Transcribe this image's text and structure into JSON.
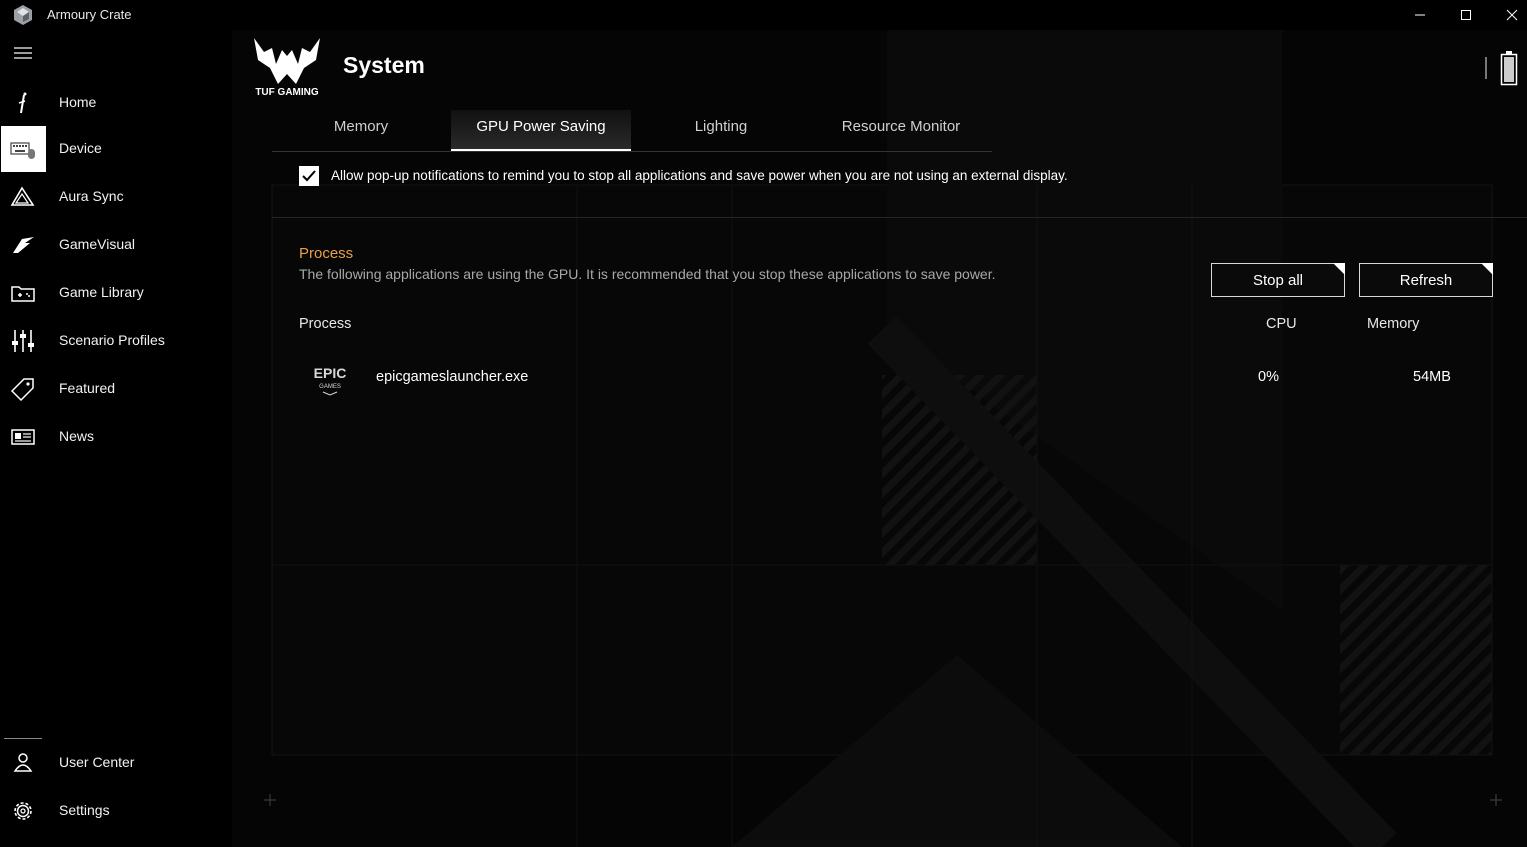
{
  "window": {
    "title": "Armoury Crate"
  },
  "sidebar": {
    "items": [
      {
        "label": "Home",
        "icon": "home-icon"
      },
      {
        "label": "Device",
        "icon": "keyboard-mouse-icon",
        "active": true
      },
      {
        "label": "Aura Sync",
        "icon": "aura-icon"
      },
      {
        "label": "GameVisual",
        "icon": "gamevisual-icon"
      },
      {
        "label": "Game Library",
        "icon": "game-library-icon"
      },
      {
        "label": "Scenario Profiles",
        "icon": "sliders-icon"
      },
      {
        "label": "Featured",
        "icon": "tag-icon"
      },
      {
        "label": "News",
        "icon": "news-icon"
      }
    ],
    "bottom": [
      {
        "label": "User Center",
        "icon": "user-icon"
      },
      {
        "label": "Settings",
        "icon": "gear-icon"
      }
    ]
  },
  "header": {
    "logo_text": "TUF GAMING",
    "title": "System"
  },
  "tabs": [
    {
      "label": "Memory"
    },
    {
      "label": "GPU Power Saving",
      "active": true
    },
    {
      "label": "Lighting"
    },
    {
      "label": "Resource Monitor"
    }
  ],
  "notification": {
    "checked": true,
    "label": "Allow pop-up notifications to remind you to stop all applications and save power when you are not using an external display."
  },
  "process_section": {
    "title": "Process",
    "description": "The following applications are using the GPU. It is recommended that you stop these applications to save power.",
    "stop_all_label": "Stop all",
    "refresh_label": "Refresh",
    "columns": {
      "process": "Process",
      "cpu": "CPU",
      "memory": "Memory"
    },
    "rows": [
      {
        "icon_text_top": "EPIC",
        "icon_text_bottom": "GAMES",
        "name": "epicgameslauncher.exe",
        "cpu": "0%",
        "memory": "54MB"
      }
    ]
  },
  "colors": {
    "accent": "#e6a04a",
    "background": "#000000",
    "text": "#ffffff"
  }
}
